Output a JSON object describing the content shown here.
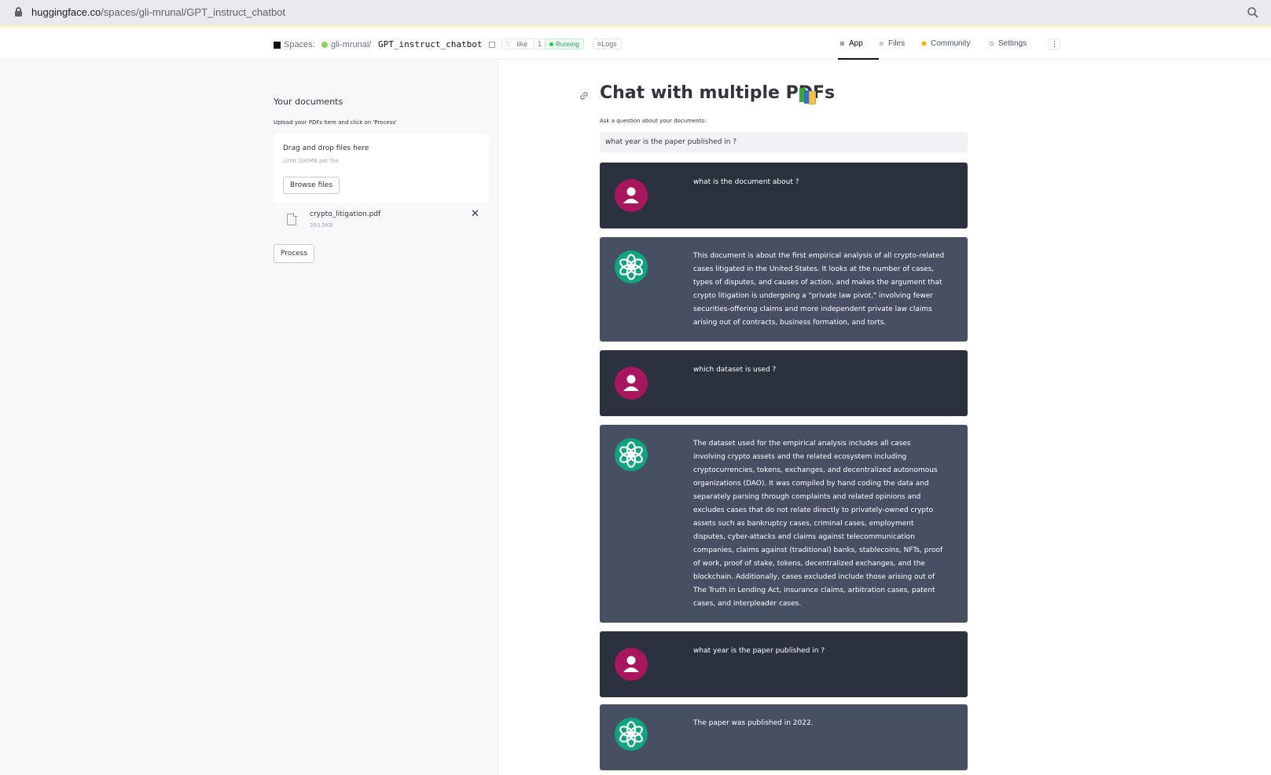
{
  "browser": {
    "url_host": "huggingface.co",
    "url_path": "/spaces/gli-mrunal/GPT_instruct_chatbot"
  },
  "header": {
    "spaces_label": "Spaces:",
    "owner": "gli-mrunal",
    "separator": "/",
    "repo": "GPT_instruct_chatbot",
    "like_label": "like",
    "like_count": "1",
    "status": "Running",
    "logs_label": "Logs",
    "nav": {
      "app": "App",
      "files": "Files",
      "community": "Community",
      "settings": "Settings"
    },
    "more_label": "⋮"
  },
  "sidebar": {
    "title": "Your documents",
    "help": "Upload your PDFs here and click on 'Process'",
    "dropzone_title": "Drag and drop files here",
    "dropzone_limit": "Limit 200MB per file",
    "browse_label": "Browse files",
    "file": {
      "name": "crypto_litigation.pdf",
      "size": "393.5KB"
    },
    "remove_label": "✕",
    "process_label": "Process"
  },
  "main": {
    "title": "Chat with multiple PDFs",
    "question_label": "Ask a question about your documents:",
    "question_value": "what year is the paper published in ?"
  },
  "messages": [
    {
      "role": "user",
      "text": "what is the document about ?"
    },
    {
      "role": "bot",
      "text": "This document is about the first empirical analysis of all crypto-related cases litigated in the United States. It looks at the number of cases, types of disputes, and causes of action, and makes the argument that crypto litigation is undergoing a \"private law pivot,\" involving fewer securities-offering claims and more independent private law claims arising out of contracts, business formation, and torts."
    },
    {
      "role": "user",
      "text": "which dataset is used ?"
    },
    {
      "role": "bot",
      "text": "The dataset used for the empirical analysis includes all cases involving crypto assets and the related ecosystem including cryptocurrencies, tokens, exchanges, and decentralized autonomous organizations (DAO). It was compiled by hand coding the data and separately parsing through complaints and related opinions and excludes cases that do not relate directly to privately-owned crypto assets such as bankruptcy cases, criminal cases, employment disputes, cyber-attacks and claims against telecommunication companies, claims against (traditional) banks, stablecoins, NFTs, proof of work, proof of stake, tokens, decentralized exchanges, and the blockchain. Additionally, cases excluded include those arising out of The Truth in Lending Act, insurance claims, arbitration cases, patent cases, and interpleader cases."
    },
    {
      "role": "user",
      "text": "what year is the paper published in ?"
    },
    {
      "role": "bot",
      "text": "The paper was published in 2022."
    }
  ],
  "colors": {
    "user_bubble": "#2b313e",
    "bot_bubble": "#475063",
    "user_avatar": "#a8165e",
    "bot_avatar": "#10a37f"
  }
}
